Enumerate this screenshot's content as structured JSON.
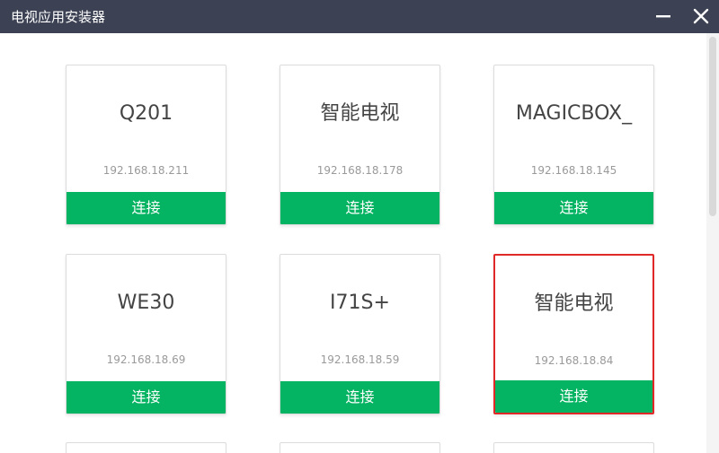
{
  "window": {
    "title": "电视应用安装器"
  },
  "devices": [
    {
      "name": "Q201",
      "ip": "192.168.18.211",
      "connect_label": "连接"
    },
    {
      "name": "智能电视",
      "ip": "192.168.18.178",
      "connect_label": "连接"
    },
    {
      "name": "MAGICBOX_",
      "ip": "192.168.18.145",
      "connect_label": "连接"
    },
    {
      "name": "WE30",
      "ip": "192.168.18.69",
      "connect_label": "连接"
    },
    {
      "name": "I71S+",
      "ip": "192.168.18.59",
      "connect_label": "连接"
    },
    {
      "name": "智能电视",
      "ip": "192.168.18.84",
      "connect_label": "连接"
    }
  ],
  "colors": {
    "titlebar": "#3c4254",
    "connect_button": "#05b462",
    "selected_border": "#e02828"
  },
  "icons": {
    "minimize": "minimize-icon",
    "close": "close-icon"
  }
}
